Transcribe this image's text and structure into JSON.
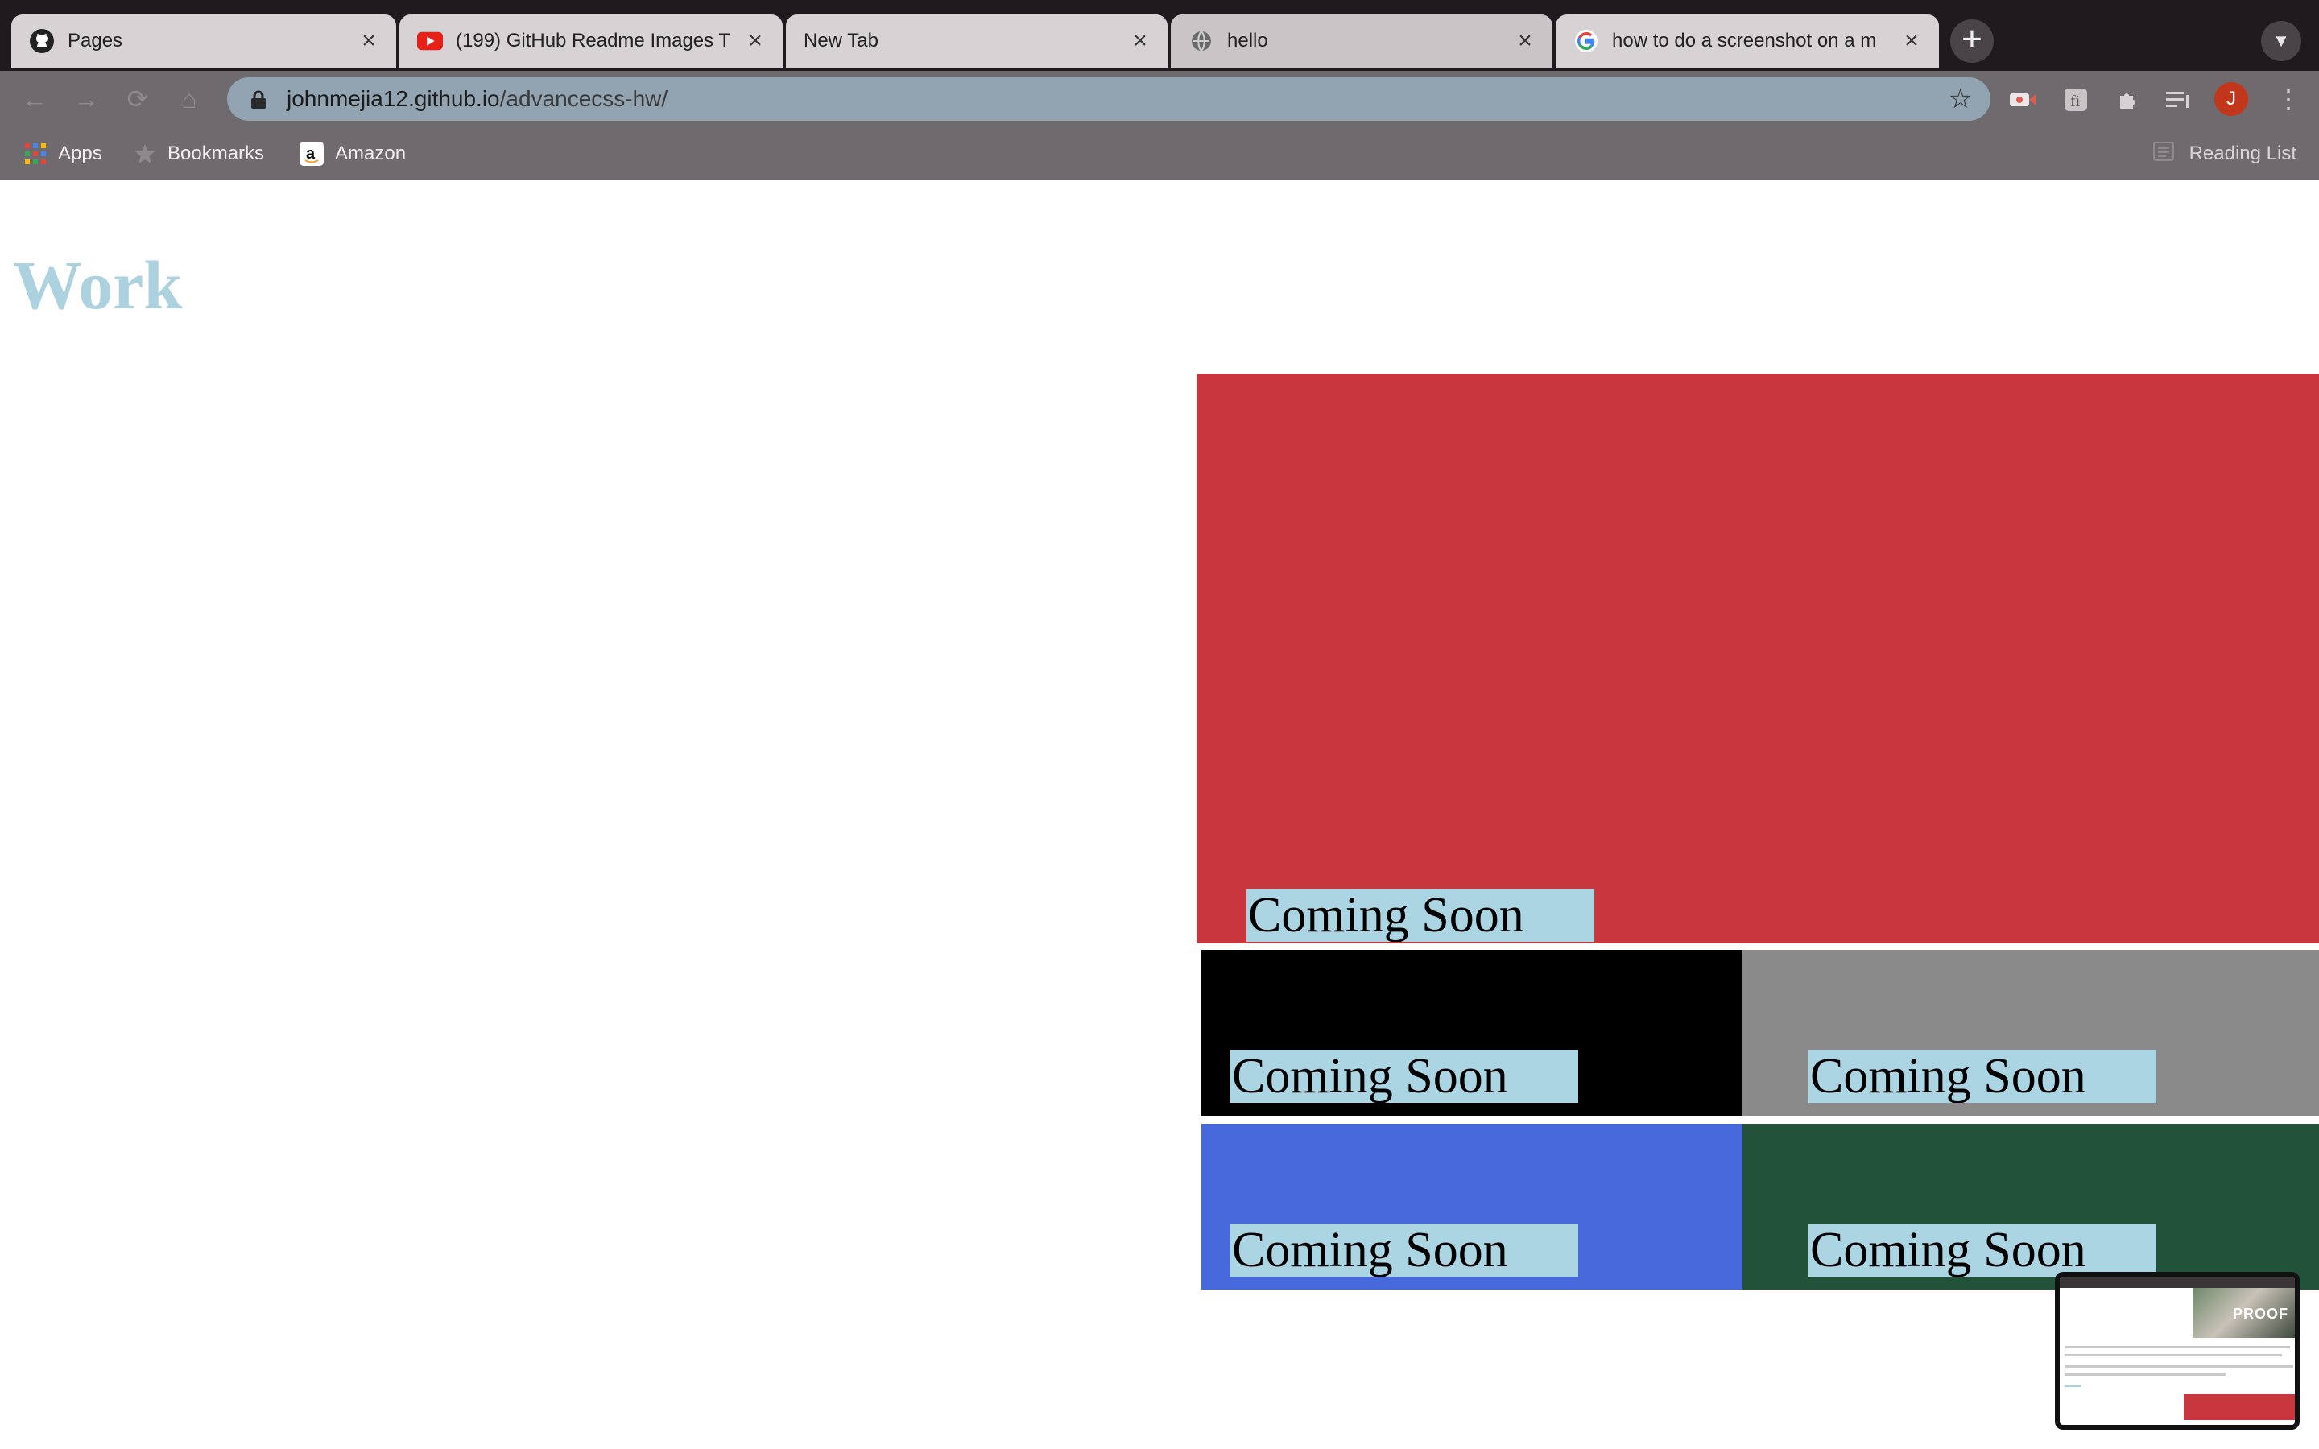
{
  "browser": {
    "tabs": [
      {
        "title": "Pages",
        "favicon": "github-icon",
        "active": false
      },
      {
        "title": "(199) GitHub Readme Images T",
        "favicon": "youtube-icon",
        "active": false
      },
      {
        "title": "New Tab",
        "favicon": "",
        "active": false
      },
      {
        "title": "hello",
        "favicon": "globe-icon",
        "active": true
      },
      {
        "title": "how to do a screenshot on a m",
        "favicon": "google-icon",
        "active": false
      }
    ],
    "address_bar": {
      "host": "johnmejia12.github.io",
      "path": "/advancecss-hw/"
    },
    "profile_initial": "J",
    "bookmarks": [
      {
        "label": "Apps",
        "icon": "apps-grid-icon"
      },
      {
        "label": "Bookmarks",
        "icon": "star-icon"
      },
      {
        "label": "Amazon",
        "icon": "amazon-icon"
      }
    ],
    "reading_list_label": "Reading List"
  },
  "page": {
    "heading": "Work",
    "tiles": [
      {
        "label": "Coming Soon",
        "color": "#c8373e"
      },
      {
        "label": "Coming Soon",
        "color": "#000000"
      },
      {
        "label": "Coming Soon",
        "color": "#8a8a8b"
      },
      {
        "label": "Coming Soon",
        "color": "#4869dc"
      },
      {
        "label": "Coming Soon",
        "color": "#22523a"
      }
    ],
    "heading_color": "#acd2e0",
    "badge_color": "#acd5e3"
  },
  "screenshot_preview": {
    "label": "PROOF"
  }
}
